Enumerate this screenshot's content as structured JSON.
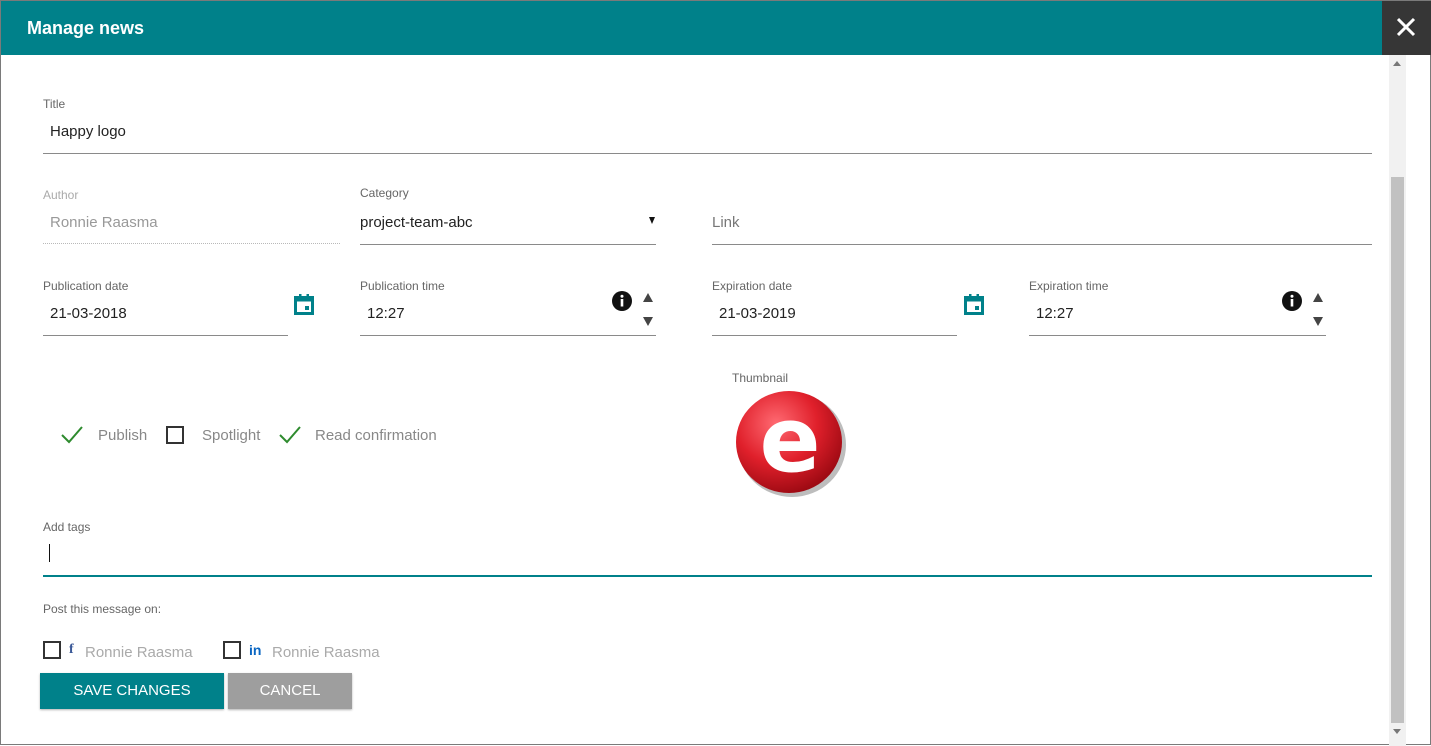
{
  "header": {
    "title": "Manage news"
  },
  "colors": {
    "accent": "#00818a",
    "close_bg": "#363636",
    "check": "#2e8b2e",
    "logo_red": "#e0202b"
  },
  "form": {
    "title": {
      "label": "Title",
      "value": "Happy logo"
    },
    "author": {
      "label": "Author",
      "value": "Ronnie Raasma"
    },
    "category": {
      "label": "Category",
      "value": "project-team-abc"
    },
    "link": {
      "placeholder": "Link"
    },
    "publication_date": {
      "label": "Publication date",
      "value": "21-03-2018"
    },
    "publication_time": {
      "label": "Publication time",
      "value": "12:27"
    },
    "expiration_date": {
      "label": "Expiration date",
      "value": "21-03-2019"
    },
    "expiration_time": {
      "label": "Expiration time",
      "value": "12:27"
    },
    "options": [
      {
        "label": "Publish",
        "checked": true
      },
      {
        "label": "Spotlight",
        "checked": false
      },
      {
        "label": "Read confirmation",
        "checked": true
      }
    ],
    "thumbnail": {
      "label": "Thumbnail",
      "logo_letter": "e"
    },
    "tags": {
      "label": "Add tags",
      "value": ""
    },
    "post_on": {
      "label": "Post this message on:",
      "accounts": [
        {
          "network": "facebook",
          "icon": "f",
          "name": "Ronnie Raasma",
          "checked": false
        },
        {
          "network": "linkedin",
          "icon": "in",
          "name": "Ronnie Raasma",
          "checked": false
        }
      ]
    }
  },
  "buttons": {
    "save": "SAVE CHANGES",
    "cancel": "CANCEL"
  }
}
